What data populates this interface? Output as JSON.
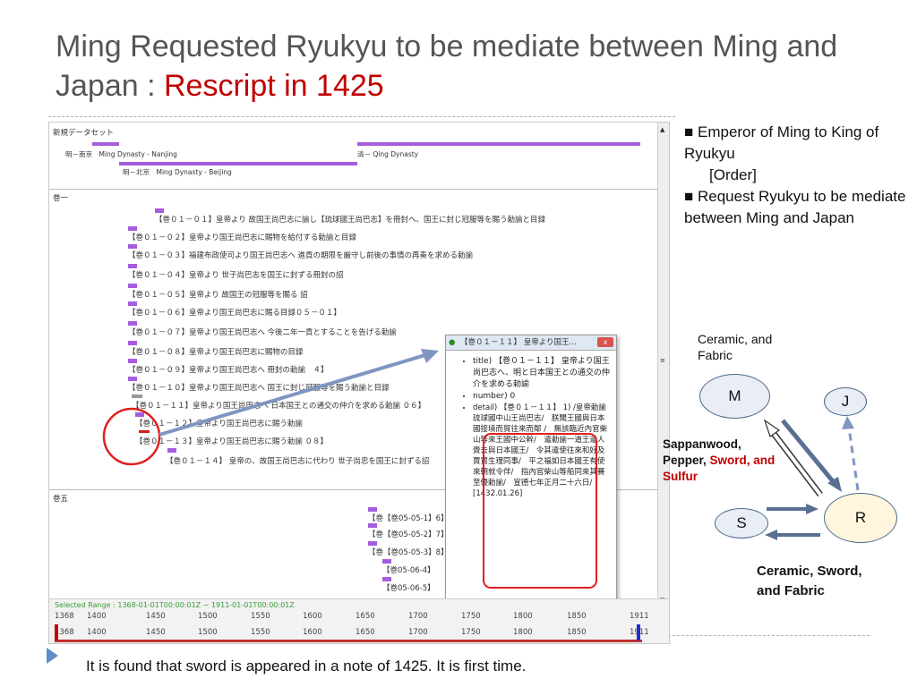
{
  "title": {
    "main": "Ming Requested Ryukyu to be mediate between Ming and Japan : ",
    "highlight": "Rescript in 1425"
  },
  "screenshot": {
    "dataset_label": "新規データセット",
    "dynasty_rows": [
      {
        "label": "明－南京　Ming Dynasty - Nanjing"
      },
      {
        "label": "明－北京　Ming Dynasty - Beijing"
      },
      {
        "label": "清－ Qing Dynasty"
      }
    ],
    "section1_label": "巻一",
    "section5_label": "巻五",
    "entries": [
      "【巻０１－０１】皇帝より 故国王尚巴志に諭し【琉球國王尚巴志】を冊封へ、国王に封じ冠服等を賜う勅諭と目録",
      "【巻０１－０２】皇帝より国王尚巴志に賜物を給付する勅諭と目録",
      "【巻０１－０３】福建布政使司より国王尚巴志へ 進貢の期限を厳守し前後の事情の再奏を求める勅諭",
      "【巻０１－０４】皇帝より 世子尚巴志を国王に封ずる冊封の詔",
      "【巻０１－０５】皇帝より 故国王の冠服等を賜る 詔",
      "【巻０１－０６】皇帝より国王尚巴志に賜る目録０５－０１】",
      "【巻０１－０７】皇帝より国王尚巴志へ 今後二年一貢とすることを告げる勅諭",
      "【巻０１－０８】皇帝より国王尚巴志に賜物の目録",
      "【巻０１－０９】皇帝より国王尚巴志へ 冊封の勅諭　４】",
      "【巻０１－１０】皇帝より国王尚巴志へ 国王に封じ冠服等を賜う勅諭と目録",
      "【巻０１－１１】皇帝より国王尚巴志へ 日本国王との通交の仲介を求める勅諭 ０６】",
      "【巻０１－１２】皇帝より国王尚巴志に賜う勅諭",
      "【巻０１－１３】皇帝より国王尚巴志に賜う勅諭 ０８】",
      "【巻０１－１４】 皇帝の、故国王尚巴志に代わり 世子尚忠を国王に封ずる詔"
    ],
    "section5_entries": [
      "【巻【巻05-05-1】6】",
      "【巻【巻05-05-2】7】",
      "【巻【巻05-05-3】8】",
      "【巻05-06-4】",
      "【巻05-06-5】"
    ],
    "selected_range": "Selected Range : 1368-01-01T00:00:01Z ~ 1911-01-01T00:00:01Z",
    "ticks": [
      "1368",
      "1400",
      "1450",
      "1500",
      "1550",
      "1600",
      "1650",
      "1700",
      "1750",
      "1800",
      "1850",
      "1911"
    ],
    "popup": {
      "title": "【巻０１－１１】 皇帝より国王…",
      "items": [
        "title) 【巻０１－１１】 皇帝より国王尚巴志へ、明と日本国王との通交の仲介を求める勅諭",
        "number) 0",
        "detail) 【巻０１－１１】 1) /皇帝勅諭琉球國中山王尚巴志/　朕聞王國與日本國接境而貿往來而鄰 /　無該臨近內官柴山等來王國中公幹/　遣勅諭一道王遣人賫去與日本國王/　令其遣使往來和好及賈賈生理同事/　平之福如日本國王有使來朝就令伴/　指內官柴山等船同來其賽至優勅諭/　宣德七年正月二十六日/ [1432.01.26]"
      ]
    }
  },
  "notes": {
    "line1": "■ Emperor of Ming to King of Ryukyu",
    "line2": "[Order]",
    "line3": "■ Request Ryukyu to  be mediate between Ming and Japan"
  },
  "diagram": {
    "m_label": "M",
    "j_label": "J",
    "s_label": "S",
    "r_label": "R",
    "top_goods": "Ceramic, and Fabric",
    "left_goods_black": "Sappanwood, Pepper, ",
    "left_goods_red": "Sword, and Sulfur",
    "bottom_goods": "Ceramic, Sword, and Fabric"
  },
  "footer": {
    "text": "It is found that sword is appeared in a note of 1425. It is first time."
  }
}
